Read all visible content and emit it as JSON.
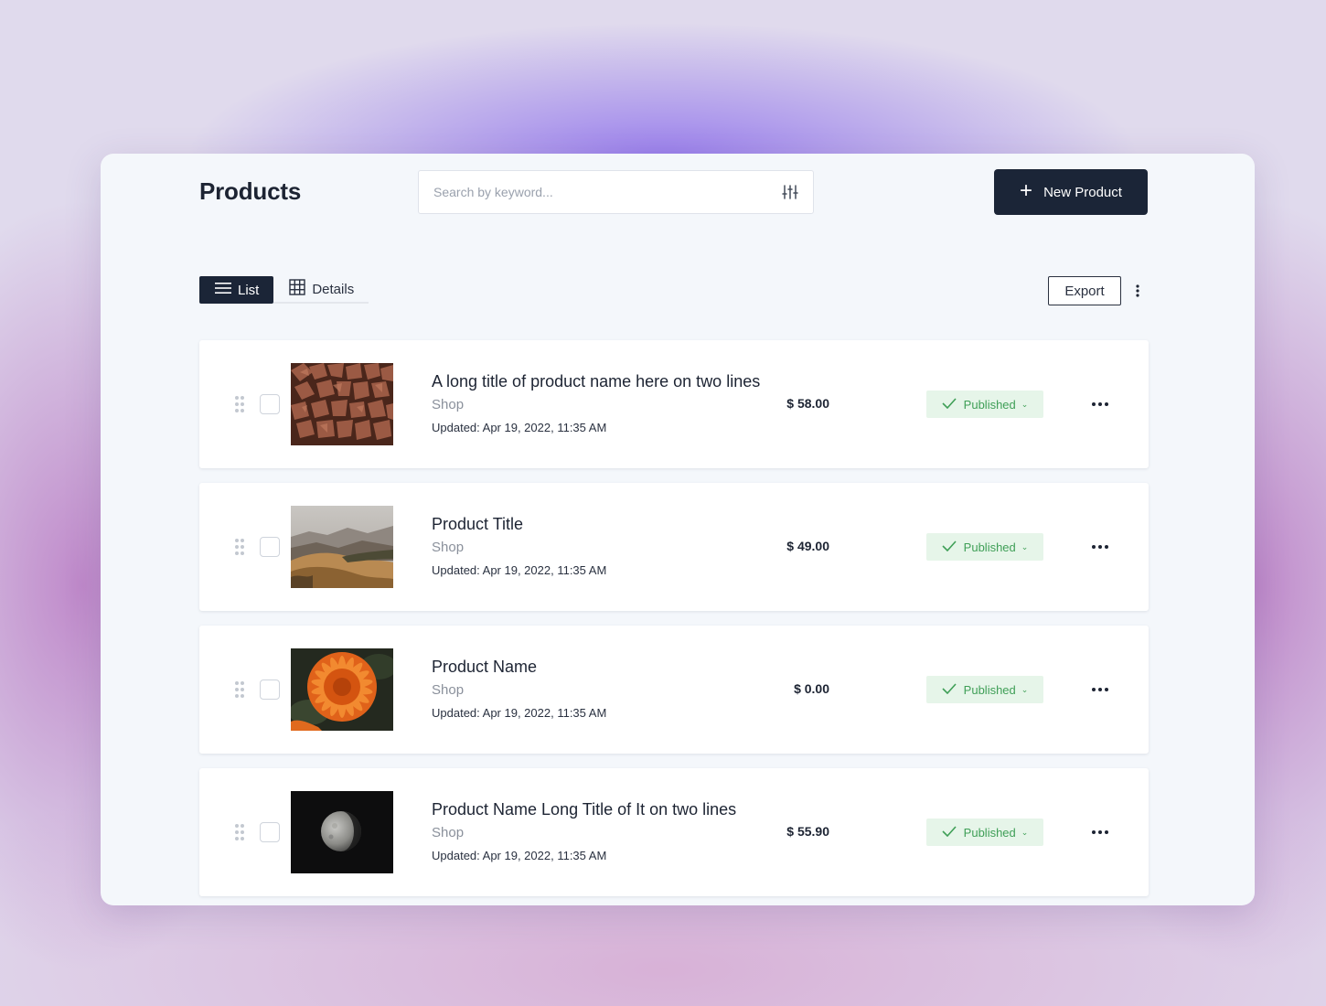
{
  "header": {
    "title": "Products",
    "search_placeholder": "Search by keyword...",
    "new_button_label": "New Product"
  },
  "toolbar": {
    "views": [
      {
        "label": "List",
        "icon": "menu-lines-icon",
        "active": true
      },
      {
        "label": "Details",
        "icon": "grid-icon",
        "active": false
      }
    ],
    "export_label": "Export"
  },
  "products": [
    {
      "name": "A long title of product name here on two lines",
      "shop": "Shop",
      "updated": "Updated: Apr 19, 2022, 11:35 AM",
      "price": "$ 58.00",
      "status": "Published",
      "image": "firewood-photo"
    },
    {
      "name": "Product Title",
      "shop": "Shop",
      "updated": "Updated: Apr 19, 2022, 11:35 AM",
      "price": "$ 49.00",
      "status": "Published",
      "image": "hills-landscape-photo"
    },
    {
      "name": "Product Name",
      "shop": "Shop",
      "updated": "Updated: Apr 19, 2022, 11:35 AM",
      "price": "$ 0.00",
      "status": "Published",
      "image": "orange-flower-photo"
    },
    {
      "name": "Product Name Long Title of It on two lines",
      "shop": "Shop",
      "updated": "Updated: Apr 19, 2022, 11:35 AM",
      "price": "$ 55.90",
      "status": "Published",
      "image": "moon-photo"
    }
  ],
  "colors": {
    "primary_dark": "#1b2537",
    "status_green": "#3f9f57",
    "status_bg": "#e6f5e9",
    "window_bg": "#f4f7fb"
  }
}
